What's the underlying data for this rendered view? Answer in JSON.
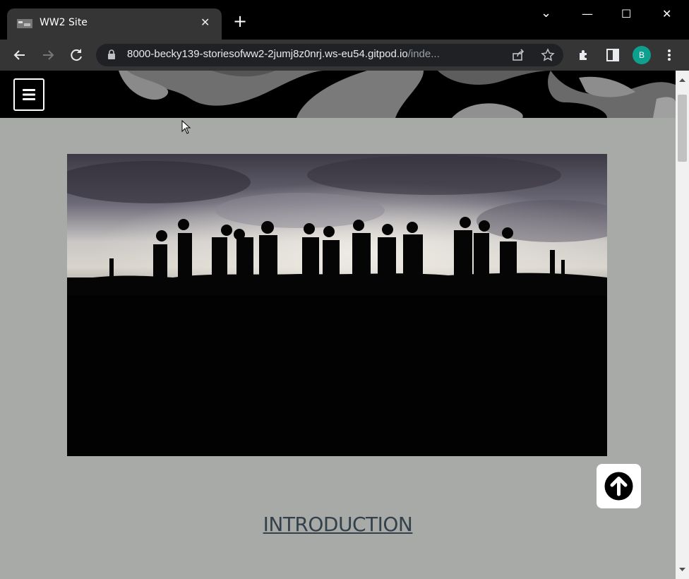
{
  "browser": {
    "tab_title": "WW2 Site",
    "tab_close": "✕",
    "new_tab": "+",
    "url_host": "8000-becky139-storiesofww2-2jumj8z0nrj.ws-eu54.gitpod.io",
    "url_path": "/inde...",
    "profile_initial": "B",
    "window_controls": {
      "chevron": "⌄",
      "minimize": "—",
      "maximize": "☐",
      "close": "✕"
    }
  },
  "site": {
    "menu_icon": "hamburger-menu-icon",
    "hero_alt_icon": "soldiers-silhouette-image",
    "intro_heading": "INTRODUCTION",
    "back_to_top_icon": "arrow-up-circle-icon"
  },
  "colors": {
    "page_bg": "#a7aaa6",
    "header_bg": "#000000",
    "heading": "#34414a",
    "profile": "#0e9f8e"
  }
}
